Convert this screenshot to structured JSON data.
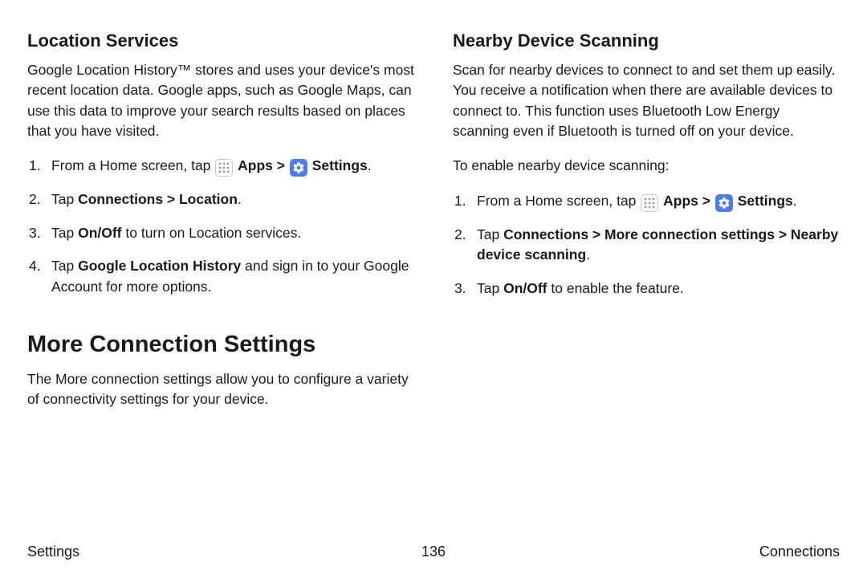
{
  "left": {
    "h2": "Location Services",
    "p1_a": "Google Location History",
    "p1_b": "™ stores and uses your device's most recent location data. Google apps, such as Google Maps, can use this data to improve your search results based on places that you have visited.",
    "li1_a": "From a Home screen, tap ",
    "li1_apps": "Apps",
    "li1_sep": " > ",
    "li1_settings": "Settings",
    "li1_dot": ".",
    "li2_a": "Tap ",
    "li2_b": "Connections > Location",
    "li2_c": ".",
    "li3_a": "Tap ",
    "li3_b": "On/Off",
    "li3_c": " to turn on Location services.",
    "li4_a": "Tap ",
    "li4_b": "Google Location History",
    "li4_c": " and sign in to your Google Account for more options.",
    "h1": "More Connection Settings",
    "p2": "The More connection settings allow you to configure a variety of connectivity settings for your device."
  },
  "right": {
    "h2": "Nearby Device Scanning",
    "p1": "Scan for nearby devices to connect to and set them up easily. You receive a notification when there are available devices to connect to. This function uses Bluetooth Low Energy scanning even if Bluetooth is turned off on your device.",
    "p2": "To enable nearby device scanning:",
    "li1_a": "From a Home screen, tap ",
    "li1_apps": "Apps",
    "li1_sep": " > ",
    "li1_settings": "Settings",
    "li1_dot": ".",
    "li2_a": "Tap ",
    "li2_b": "Connections > More connection settings > Nearby device scanning",
    "li2_c": ".",
    "li3_a": "Tap ",
    "li3_b": "On/Off",
    "li3_c": " to enable the feature."
  },
  "footer": {
    "left": "Settings",
    "center": "136",
    "right": "Connections"
  }
}
